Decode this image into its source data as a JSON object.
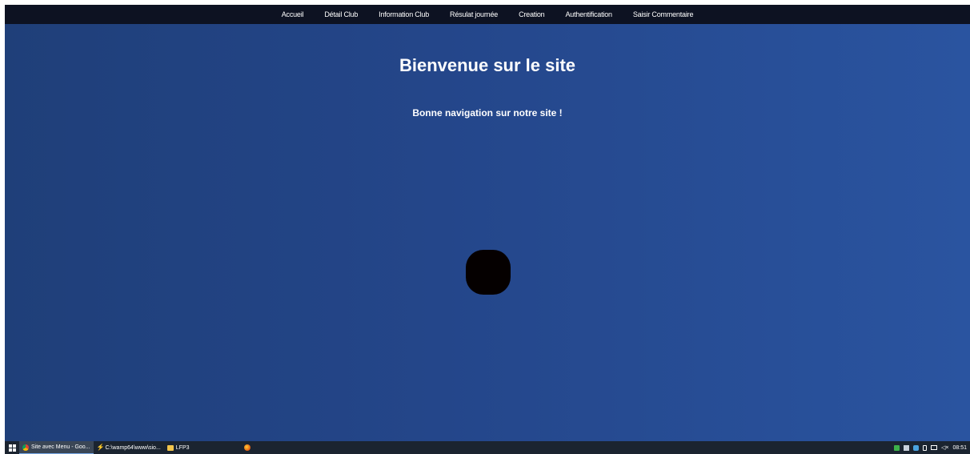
{
  "nav": {
    "items": [
      {
        "label": "Accueil"
      },
      {
        "label": "Détail Club"
      },
      {
        "label": "Information Club"
      },
      {
        "label": "Résulat journée"
      },
      {
        "label": "Creation"
      },
      {
        "label": "Authentification"
      },
      {
        "label": "Saisir Commentaire"
      }
    ]
  },
  "main": {
    "title": "Bienvenue sur le site",
    "subtitle": "Bonne navigation sur notre site !"
  },
  "taskbar": {
    "items": [
      {
        "label": "Site avec Menu - Goo...",
        "icon": "chrome-icon"
      },
      {
        "label": "C:\\wamp64\\www\\sio...",
        "icon": "wamp-icon"
      },
      {
        "label": "LFP3",
        "icon": "folder-icon"
      },
      {
        "label": "",
        "icon": "firefox-icon"
      }
    ],
    "tray": {
      "volume": "◁×",
      "time": "08:51"
    }
  },
  "colors": {
    "background": "#24468a",
    "navbar": "#0d1222",
    "taskbar": "#1b2430"
  }
}
